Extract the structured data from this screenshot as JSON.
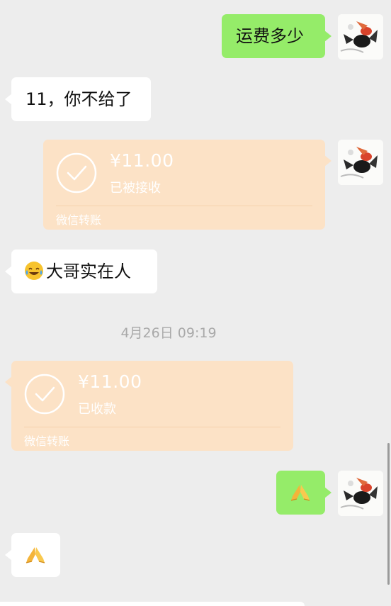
{
  "chat": {
    "messages": {
      "m1": {
        "side": "right",
        "type": "text",
        "text": "运费多少"
      },
      "m2": {
        "side": "left",
        "type": "text",
        "text": "11，你不给了"
      },
      "m3": {
        "side": "right",
        "type": "transfer",
        "amount": "¥11.00",
        "status": "已被接收",
        "footer": "微信转账"
      },
      "m4": {
        "side": "left",
        "type": "text",
        "emoji": "laughing-crying-face-icon",
        "text": "大哥实在人"
      },
      "m6": {
        "side": "left",
        "type": "transfer",
        "amount": "¥11.00",
        "status": "已收款",
        "footer": "微信转账"
      },
      "m7": {
        "side": "right",
        "type": "emoji",
        "emoji": "folded-hands-icon"
      },
      "m8": {
        "side": "left",
        "type": "emoji",
        "emoji": "folded-hands-icon"
      }
    },
    "timestamp": "4月26日 09:19"
  },
  "colors": {
    "background": "#ededed",
    "sent_bubble": "#95ec69",
    "received_bubble": "#ffffff",
    "transfer_card": "#fce2c6",
    "timestamp_text": "#a9a9a9"
  }
}
